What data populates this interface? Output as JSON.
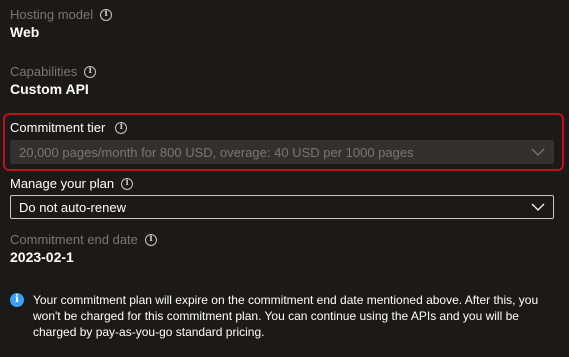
{
  "hosting_model": {
    "label": "Hosting model",
    "value": "Web"
  },
  "capabilities": {
    "label": "Capabilities",
    "value": "Custom API"
  },
  "commitment_tier": {
    "label": "Commitment tier",
    "selected": "20,000 pages/month for 800 USD, overage: 40 USD per 1000 pages",
    "disabled": true
  },
  "manage_plan": {
    "label": "Manage your plan",
    "selected": "Do not auto-renew"
  },
  "commitment_end": {
    "label": "Commitment end date",
    "value": "2023-02-1"
  },
  "info_message": {
    "text": "Your commitment plan will expire on the commitment end date mentioned above. After this, you won't be charged for this commitment plan. You can continue using the APIs and you will be charged by pay-as-you-go standard pricing."
  },
  "icons": {
    "info": "info-icon",
    "chevron": "chevron-down-icon"
  },
  "colors": {
    "background": "#1b1a19",
    "highlight": "#c50f1f",
    "info_accent": "#3aa0f3",
    "muted_text": "#797775"
  }
}
